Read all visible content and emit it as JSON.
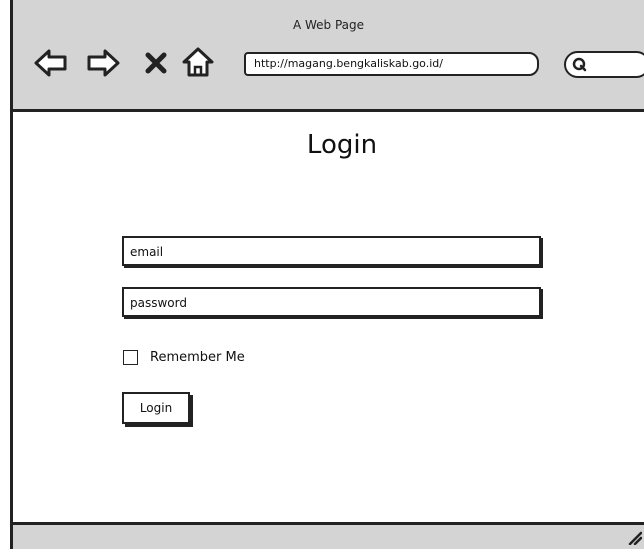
{
  "window": {
    "title": "A Web Page"
  },
  "toolbar": {
    "icons": [
      "back-arrow-icon",
      "forward-arrow-icon",
      "close-icon",
      "home-icon"
    ],
    "url": "http://magang.bengkaliskab.go.id/",
    "search_icon": "search-icon"
  },
  "main": {
    "title": "Login",
    "email_placeholder": "email",
    "password_placeholder": "password",
    "remember_label": "Remember Me",
    "login_label": "Login"
  },
  "colors": {
    "chrome": "#d4d4d4",
    "stroke": "#222222",
    "background": "#ffffff"
  }
}
